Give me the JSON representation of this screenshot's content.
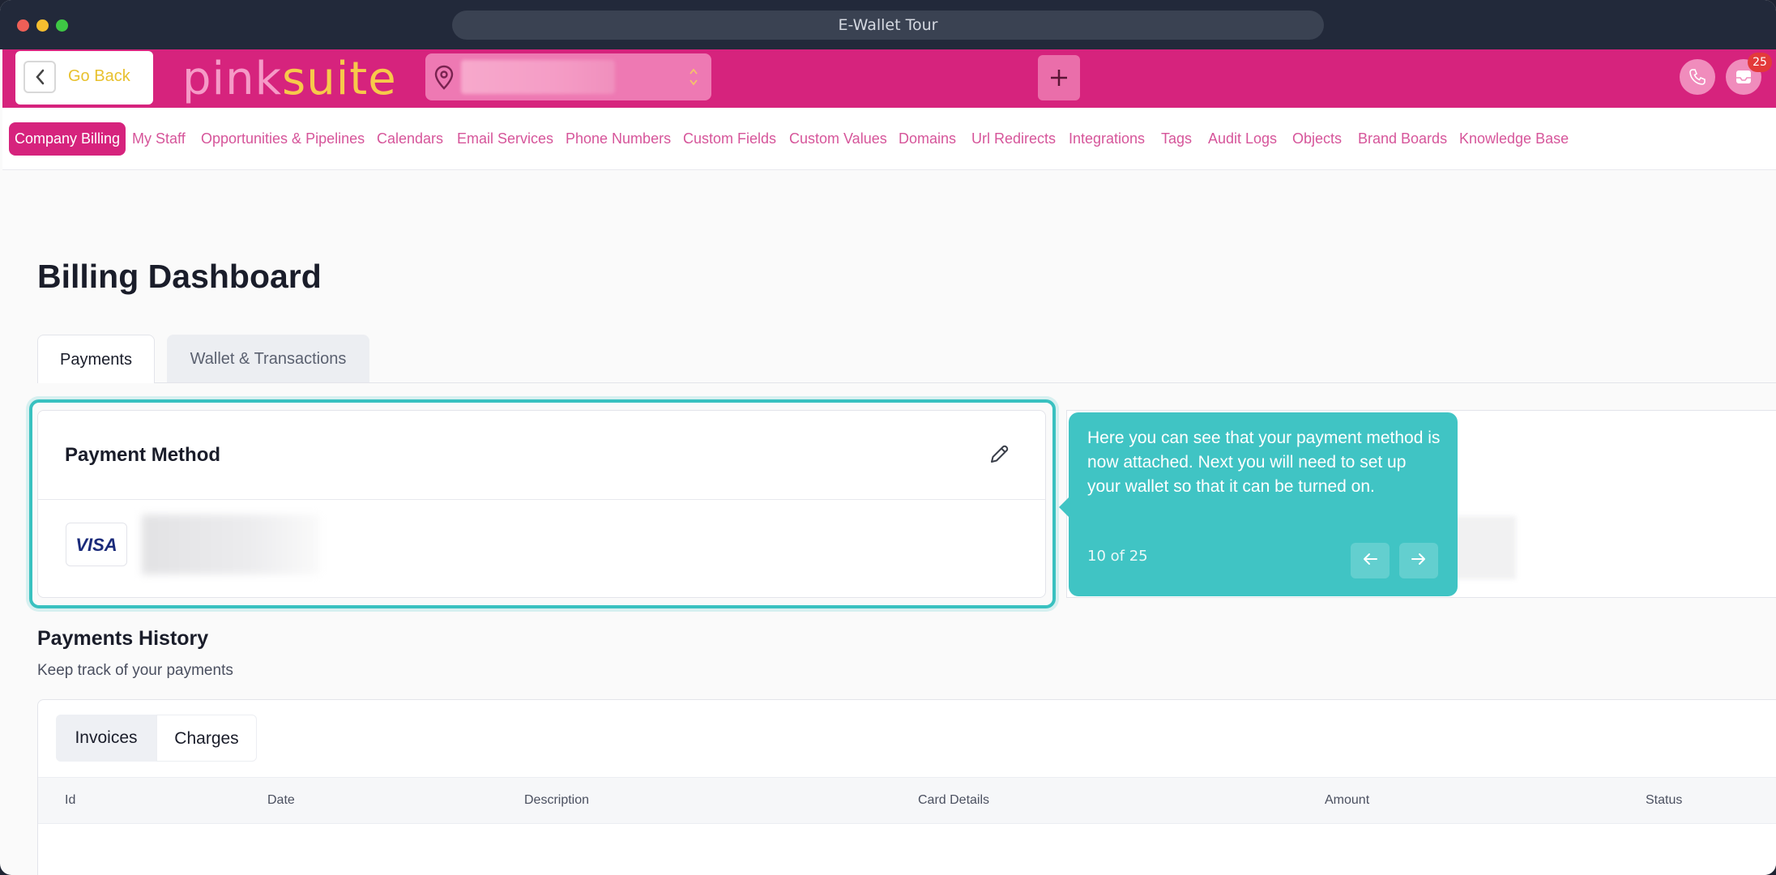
{
  "window": {
    "title": "E-Wallet Tour"
  },
  "header": {
    "go_back_label": "Go Back",
    "logo": {
      "part1": "pink",
      "part2": "suite"
    },
    "notification_count": "25",
    "colors": {
      "brand": "#d6237d",
      "logo_pink": "#f59ac7",
      "logo_gold": "#f7c94a"
    }
  },
  "nav": {
    "items": [
      {
        "label": "Company Billing",
        "active": true
      },
      {
        "label": "My Staff"
      },
      {
        "label": "Opportunities & Pipelines"
      },
      {
        "label": "Calendars"
      },
      {
        "label": "Email Services"
      },
      {
        "label": "Phone Numbers"
      },
      {
        "label": "Custom Fields"
      },
      {
        "label": "Custom Values"
      },
      {
        "label": "Domains"
      },
      {
        "label": "Url Redirects"
      },
      {
        "label": "Integrations"
      },
      {
        "label": "Tags"
      },
      {
        "label": "Audit Logs"
      },
      {
        "label": "Objects"
      },
      {
        "label": "Brand Boards"
      },
      {
        "label": "Knowledge Base"
      }
    ]
  },
  "main": {
    "title": "Billing Dashboard",
    "tabs": [
      {
        "label": "Payments",
        "active": true
      },
      {
        "label": "Wallet & Transactions"
      }
    ],
    "payment_method": {
      "title": "Payment Method",
      "card_brand": "VISA"
    },
    "tour": {
      "text": "Here you can see that your payment method is now attached. Next you will need to set up your wallet so that it can be turned on.",
      "step": "10 of 25",
      "accent": "#40c4c4"
    },
    "history": {
      "title": "Payments History",
      "subtitle": "Keep track of your payments",
      "tabs": [
        {
          "label": "Invoices",
          "active": true
        },
        {
          "label": "Charges"
        }
      ],
      "columns": [
        "Id",
        "Date",
        "Description",
        "Card Details",
        "Amount",
        "Status"
      ]
    }
  }
}
